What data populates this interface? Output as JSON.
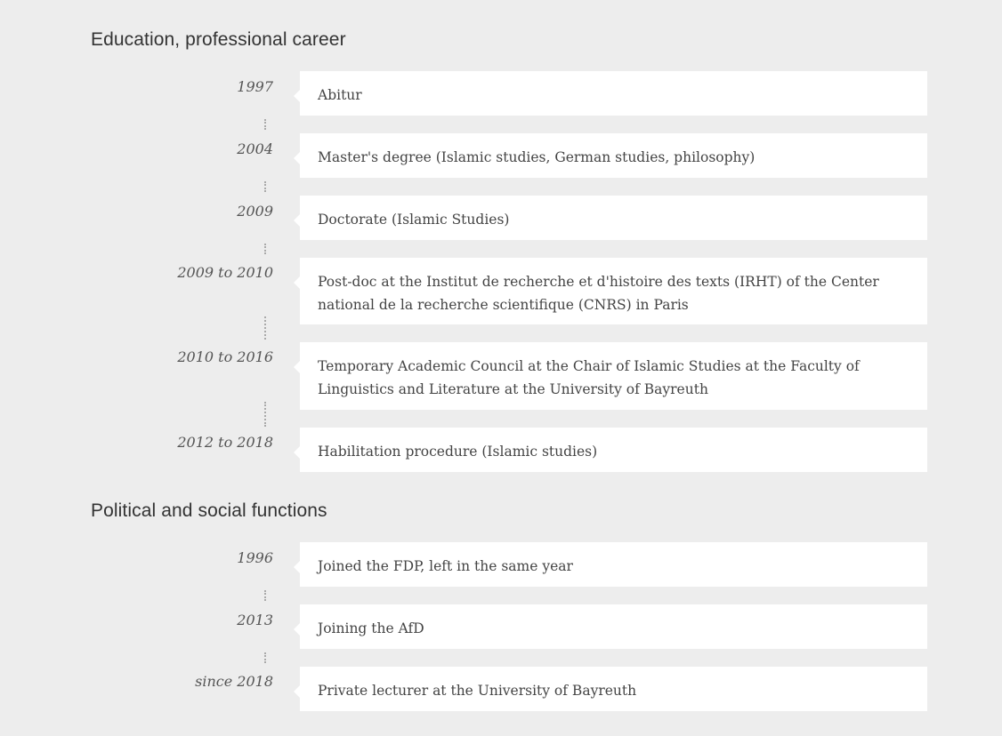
{
  "sections": [
    {
      "title": "Education, professional career",
      "entries": [
        {
          "year": "1997",
          "text": "Abitur"
        },
        {
          "year": "2004",
          "text": "Master's degree (Islamic studies, German studies, philosophy)"
        },
        {
          "year": "2009",
          "text": "Doctorate (Islamic Studies)"
        },
        {
          "year": "2009 to 2010",
          "text": "Post-doc at the Institut de recherche et d'histoire des texts (IRHT) of the Center national de la recherche scientifique (CNRS) in Paris"
        },
        {
          "year": "2010 to 2016",
          "text": "Temporary Academic Council at the Chair of Islamic Studies at the Faculty of Linguistics and Literature at the University of Bayreuth"
        },
        {
          "year": "2012 to 2018",
          "text": "Habilitation procedure (Islamic studies)"
        }
      ]
    },
    {
      "title": "Political and social functions",
      "entries": [
        {
          "year": "1996",
          "text": "Joined the FDP, left in the same year"
        },
        {
          "year": "2013",
          "text": "Joining the AfD"
        },
        {
          "year": "since 2018",
          "text": "Private lecturer at the University of Bayreuth"
        }
      ]
    }
  ]
}
